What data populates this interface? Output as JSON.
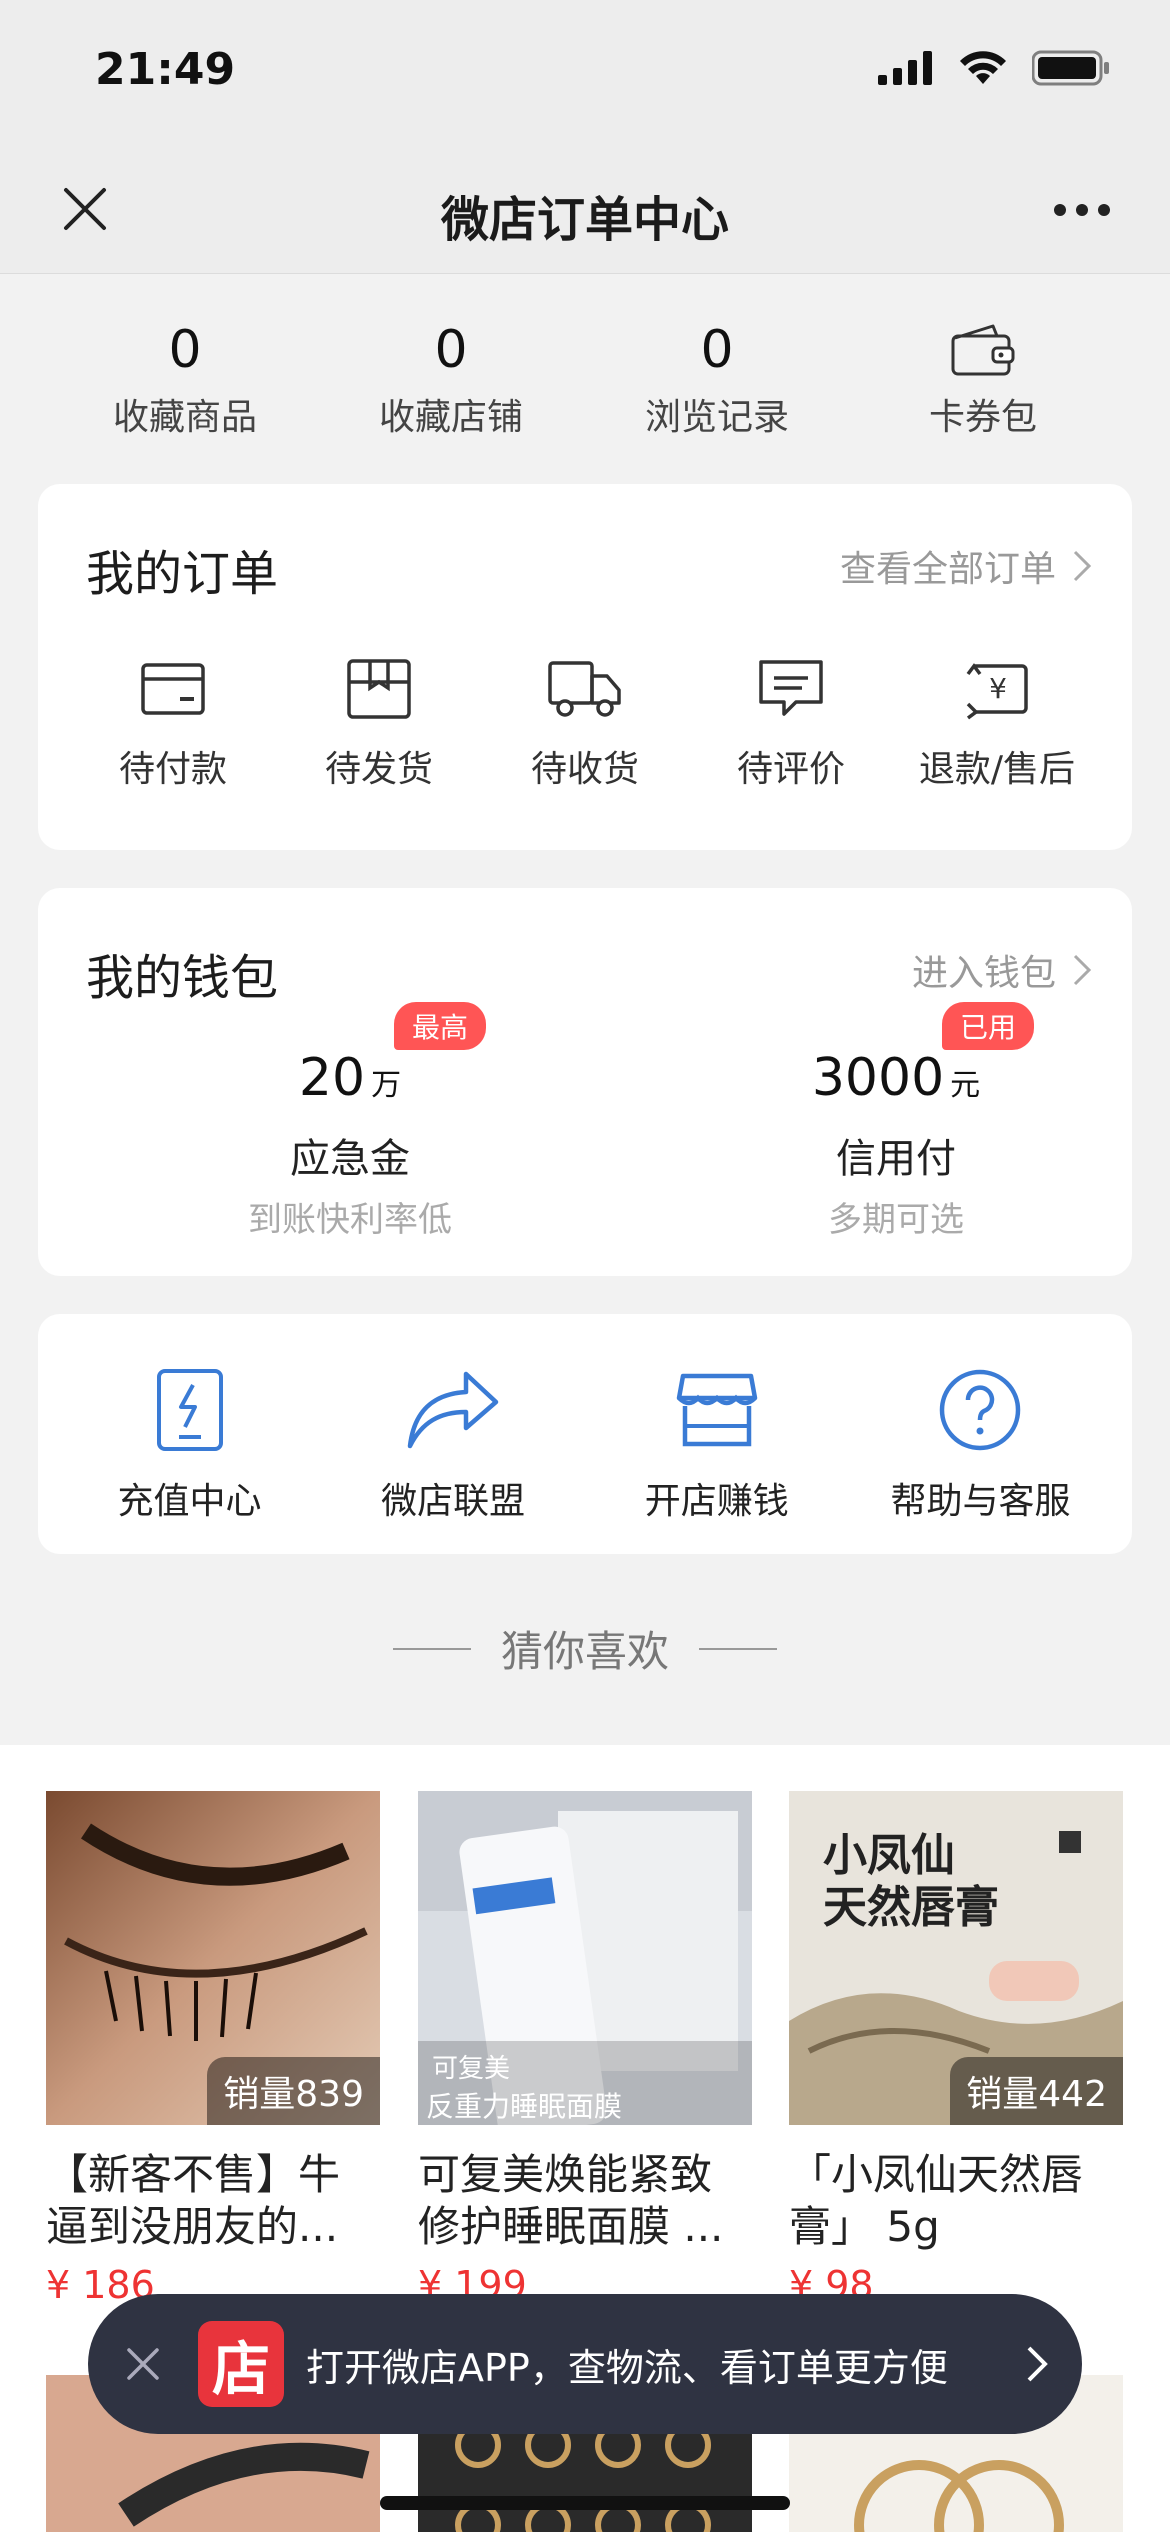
{
  "status_bar": {
    "time": "21:49"
  },
  "nav": {
    "title": "微店订单中心"
  },
  "stats": [
    {
      "value": "0",
      "label": "收藏商品"
    },
    {
      "value": "0",
      "label": "收藏店铺"
    },
    {
      "value": "0",
      "label": "浏览记录"
    },
    {
      "label": "卡券包",
      "icon": "wallet-icon"
    }
  ],
  "orders": {
    "title": "我的订单",
    "link": "查看全部订单",
    "items": [
      {
        "label": "待付款",
        "icon": "card-icon"
      },
      {
        "label": "待发货",
        "icon": "box-icon"
      },
      {
        "label": "待收货",
        "icon": "truck-icon"
      },
      {
        "label": "待评价",
        "icon": "comment-icon"
      },
      {
        "label": "退款/售后",
        "icon": "refund-icon"
      }
    ]
  },
  "wallet": {
    "title": "我的钱包",
    "link": "进入钱包",
    "items": [
      {
        "amount": "20",
        "unit": "万",
        "badge": "最高",
        "name": "应急金",
        "sub": "到账快利率低"
      },
      {
        "amount": "3000",
        "unit": "元",
        "badge": "已用",
        "name": "信用付",
        "sub": "多期可选"
      }
    ]
  },
  "services": [
    {
      "label": "充值中心",
      "icon": "recharge-icon"
    },
    {
      "label": "微店联盟",
      "icon": "share-icon"
    },
    {
      "label": "开店赚钱",
      "icon": "store-icon"
    },
    {
      "label": "帮助与客服",
      "icon": "help-icon"
    }
  ],
  "guess": {
    "title": "猜你喜欢"
  },
  "products": [
    {
      "sales": "销量839",
      "title": "【新客不售】牛逼到没朋友的...",
      "price": "¥ 186"
    },
    {
      "sales": "",
      "title": "可复美焕能紧致修护睡眠面膜 ...",
      "price": "¥ 199",
      "img_text_1": "可复美",
      "img_text_2": "反重力睡眠面膜"
    },
    {
      "sales": "销量442",
      "title": "「小凤仙天然唇膏」 5g",
      "price": "¥ 98",
      "img_text_1": "小凤仙",
      "img_text_2": "天然唇膏"
    }
  ],
  "banner": {
    "logo": "店",
    "text": "打开微店APP，查物流、看订单更方便"
  },
  "colors": {
    "accent_blue": "#3a7bd5",
    "badge_red": "#ff5555",
    "price_red": "#e33333",
    "banner_bg": "#2f3342"
  }
}
